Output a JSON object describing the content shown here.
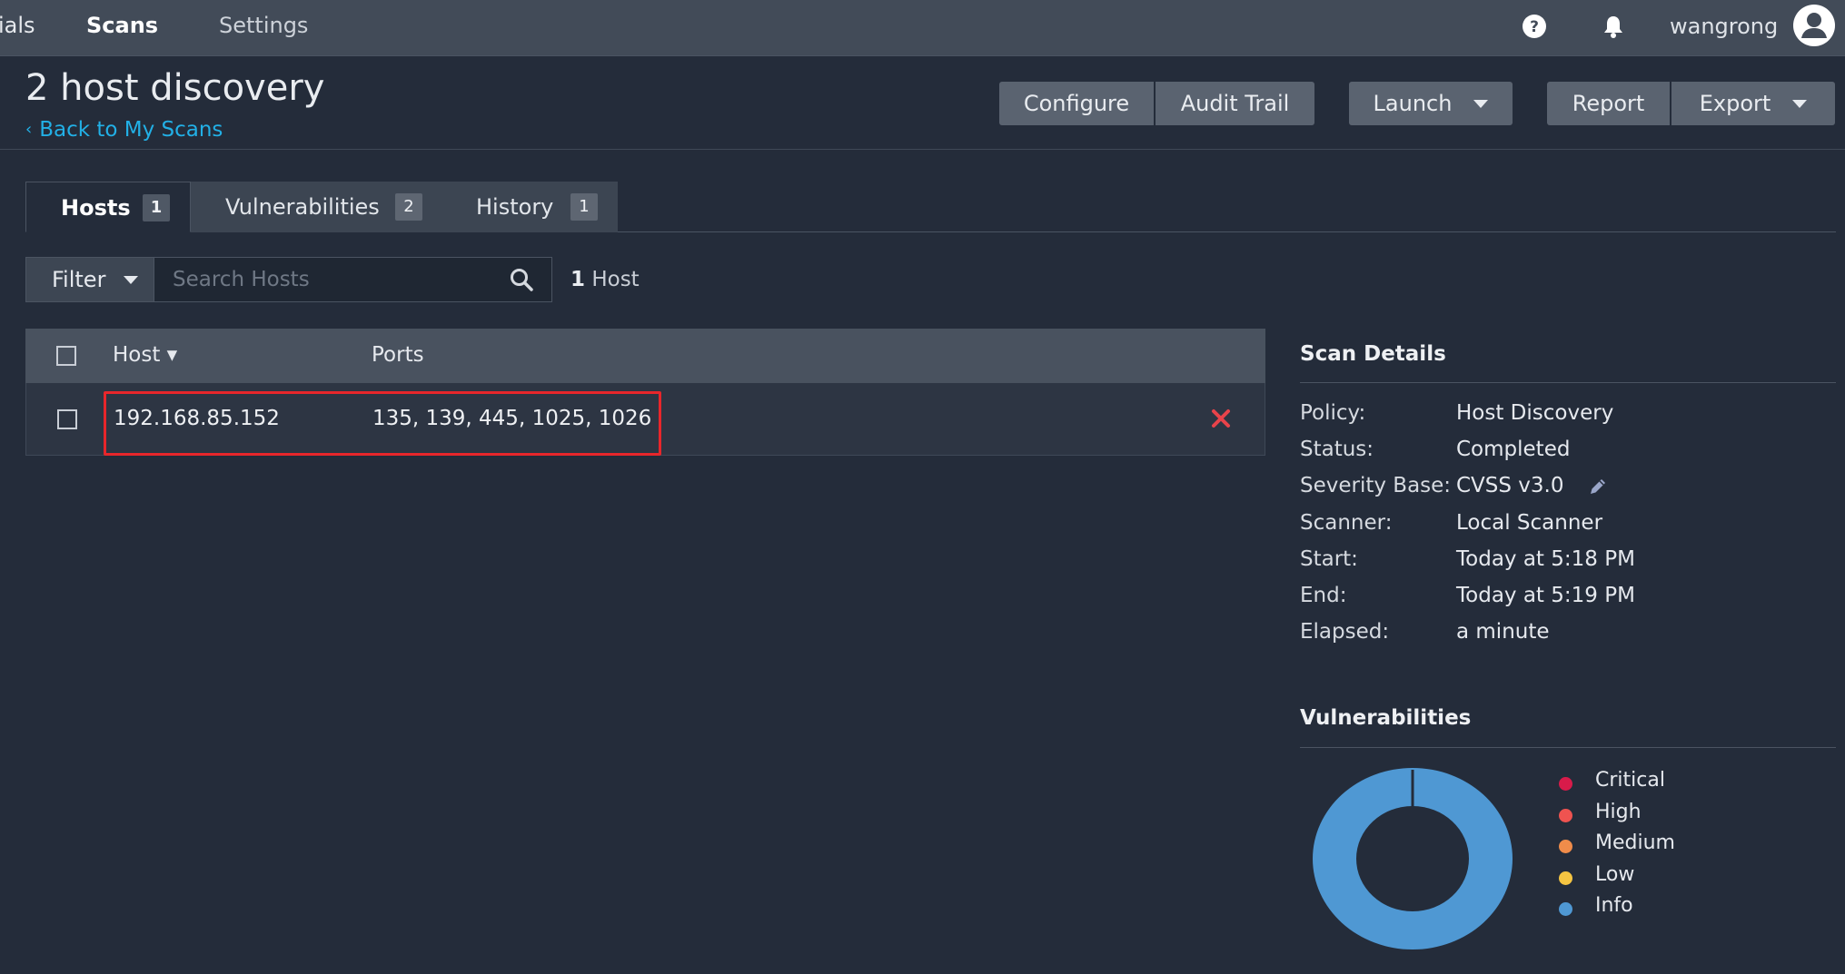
{
  "nav": {
    "credentials_fragment": "ials",
    "scans": "Scans",
    "settings": "Settings",
    "username": "wangrong"
  },
  "header": {
    "title": "2 host discovery",
    "back_link": "Back to My Scans",
    "buttons": {
      "configure": "Configure",
      "audit_trail": "Audit Trail",
      "launch": "Launch",
      "report": "Report",
      "export": "Export"
    }
  },
  "tabs": [
    {
      "label": "Hosts",
      "count": "1",
      "active": true
    },
    {
      "label": "Vulnerabilities",
      "count": "2",
      "active": false
    },
    {
      "label": "History",
      "count": "1",
      "active": false
    }
  ],
  "toolbar": {
    "filter_label": "Filter",
    "search_placeholder": "Search Hosts",
    "host_count_number": "1",
    "host_count_suffix": " Host"
  },
  "table": {
    "columns": [
      "Host ▾",
      "Ports"
    ],
    "rows": [
      {
        "host": "192.168.85.152",
        "ports": "135, 139, 445, 1025, 1026"
      }
    ]
  },
  "scan_details": {
    "title": "Scan Details",
    "rows": [
      {
        "label": "Policy:",
        "value": "Host Discovery"
      },
      {
        "label": "Status:",
        "value": "Completed"
      },
      {
        "label": "Severity Base:",
        "value": "CVSS v3.0"
      },
      {
        "label": "Scanner:",
        "value": "Local Scanner"
      },
      {
        "label": "Start:",
        "value": "Today at 5:18 PM"
      },
      {
        "label": "End:",
        "value": "Today at 5:19 PM"
      },
      {
        "label": "Elapsed:",
        "value": "a minute"
      }
    ]
  },
  "vulnerabilities": {
    "title": "Vulnerabilities",
    "legend": [
      {
        "label": "Critical",
        "color": "#d81b4a"
      },
      {
        "label": "High",
        "color": "#ef5350"
      },
      {
        "label": "Medium",
        "color": "#f08c4a"
      },
      {
        "label": "Low",
        "color": "#f5c542"
      },
      {
        "label": "Info",
        "color": "#4f98d3"
      }
    ],
    "distribution": {
      "Critical": 0,
      "High": 0,
      "Medium": 0,
      "Low": 0,
      "Info": 100
    }
  },
  "colors": {
    "accent_link": "#22b0e6",
    "highlight_box": "#e8262b",
    "remove_icon": "#e8434a"
  }
}
